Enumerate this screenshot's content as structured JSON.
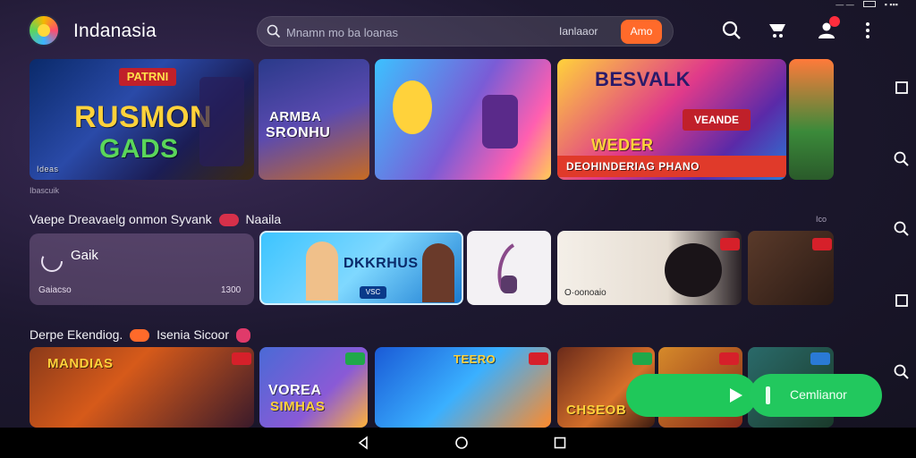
{
  "status": {
    "left": "— —",
    "right": "▪ ▪▪▪"
  },
  "header": {
    "app_title": "Indanasia",
    "search_placeholder": "Mnamn mo ba loanas",
    "search_filter": "Ianlaaor",
    "search_button": "Amo"
  },
  "banners": [
    {
      "title": "RUSMON",
      "subtitle": "GADS",
      "top_badge": "PATRNI",
      "caption": "Ideas"
    },
    {
      "title": "ARMBA",
      "subtitle": "SRONHU"
    },
    {
      "title": ""
    },
    {
      "title": "BESVALK",
      "subtitle": "WEDER",
      "ribbon": "DEOHINDERIAG PHANO",
      "badge": "VEANDE"
    },
    {
      "title": ""
    }
  ],
  "banner_caption": "Ibascuik",
  "section1": {
    "title": "Vaepe Dreavaelg",
    "sub": "onmon Syvank",
    "tail": "Naaila",
    "right": "Ico"
  },
  "row2": {
    "first": {
      "top": "Gaik",
      "bottom_left": "Gaiacso",
      "bottom_right": "1300"
    },
    "second": {
      "title": "DKKRHUS",
      "chip": "VSC"
    },
    "fourth": {
      "caption": "O·oonoaio"
    }
  },
  "section2": {
    "title": "Derpe Ekendiog.",
    "sub": "Isenia Sicoor"
  },
  "row3": [
    {
      "title": "MANDIAS"
    },
    {
      "title": "VOREA",
      "subtitle": "SIMHAS"
    },
    {
      "title": "TEERO"
    },
    {
      "title": "CHSEOB"
    },
    {
      "title": ""
    },
    {
      "title": ""
    }
  ],
  "continue_button": "Cemlianor",
  "colors": {
    "accent": "#ff6a2a",
    "green": "#22c85e",
    "badge": "#ff2d3d"
  }
}
